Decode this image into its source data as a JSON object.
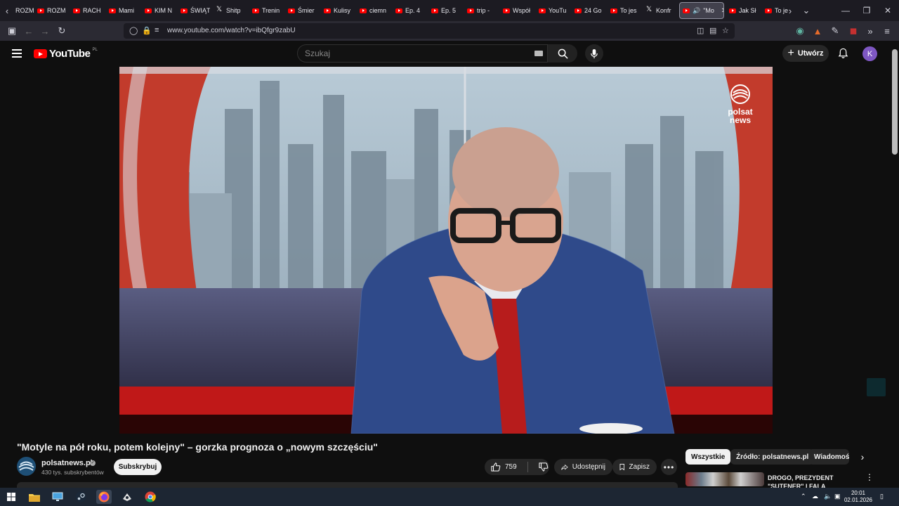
{
  "browser": {
    "tabs": [
      {
        "label": "ROZM",
        "icon": "x-twitter-favicon"
      },
      {
        "label": "ROZM",
        "icon": "youtube-favicon"
      },
      {
        "label": "RACH",
        "icon": "youtube-favicon"
      },
      {
        "label": "Mami",
        "icon": "youtube-favicon"
      },
      {
        "label": "KIM N",
        "icon": "youtube-favicon"
      },
      {
        "label": "ŚWIĄT",
        "icon": "youtube-favicon"
      },
      {
        "label": "Shitp",
        "icon": "x-twitter-favicon"
      },
      {
        "label": "Trenin",
        "icon": "youtube-favicon"
      },
      {
        "label": "Śmier",
        "icon": "youtube-favicon"
      },
      {
        "label": "Kulisy",
        "icon": "youtube-favicon"
      },
      {
        "label": "ciemn",
        "icon": "youtube-favicon"
      },
      {
        "label": "Ep. 4",
        "icon": "youtube-favicon"
      },
      {
        "label": "Ep. 5",
        "icon": "youtube-favicon"
      },
      {
        "label": "trip -",
        "icon": "youtube-favicon"
      },
      {
        "label": "Współ",
        "icon": "youtube-favicon"
      },
      {
        "label": "YouTu",
        "icon": "youtube-favicon"
      },
      {
        "label": "24 Go",
        "icon": "youtube-favicon"
      },
      {
        "label": "To jes",
        "icon": "youtube-favicon"
      },
      {
        "label": "Konfr",
        "icon": "x-twitter-favicon"
      },
      {
        "label": "\"Mo",
        "icon": "youtube-favicon",
        "active": true
      },
      {
        "label": "Jak Sł",
        "icon": "youtube-favicon"
      },
      {
        "label": "To je",
        "icon": "youtube-favicon"
      }
    ],
    "url": "www.youtube.com/watch?v=ibQfgr9zabU"
  },
  "youtube": {
    "logo_text": "YouTube",
    "region": "PL",
    "search_placeholder": "Szukaj",
    "create_label": "Utwórz",
    "avatar_letter": "K",
    "colors": {
      "brand": "#ff0000",
      "avatar": "#7e57c2",
      "background": "#0f0f0f"
    }
  },
  "video": {
    "overlay_logo_line1": "polsat",
    "overlay_logo_line2": "news",
    "title": "\"Motyle na pół roku, potem kolejny\" – gorzka prognoza o „nowym szczęściu\"",
    "channel_name": "polsatnews.pl",
    "subscribers": "430 tys. subskrybentów",
    "subscribe_label": "Subskrybuj",
    "likes": "759",
    "share_label": "Udostępnij",
    "save_label": "Zapisz"
  },
  "sidebar": {
    "chips": [
      "Wszystkie",
      "Źródło: polsatnews.pl",
      "Wiadomości"
    ],
    "recommendation_title": "DROGO, PREZYDENT \"SUTENER\" I FALA UKRAIŃCÓ..."
  },
  "taskbar": {
    "time": "20:01",
    "date": "02.01.2026"
  }
}
